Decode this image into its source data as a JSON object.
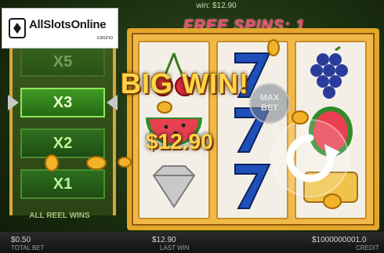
{
  "logo": {
    "brand": "AllSlotsOnline",
    "sub": ".casino"
  },
  "top_win": "win: $12.90",
  "free_spins": "FREE SPINS: 1",
  "multipliers": [
    {
      "label": "X5",
      "state": "dim"
    },
    {
      "label": "X3",
      "state": "active"
    },
    {
      "label": "X2",
      "state": "normal"
    },
    {
      "label": "X1",
      "state": "normal"
    }
  ],
  "ladder_label": "ALL REEL WINS",
  "big_win": "BIG WIN!",
  "win_amount": "$12.90",
  "max_bet": {
    "line1": "MAX",
    "line2": "BET"
  },
  "bottom": {
    "total_bet_value": "$0.50",
    "total_bet_label": "TOTAL BET",
    "last_win_value": "$12.90",
    "last_win_label": "LAST WIN",
    "credit_value": "$1000000001.0",
    "credit_label": "CREDIT"
  },
  "icons": [
    "cherry-icon",
    "seven-icon",
    "grapes-icon",
    "watermelon-icon",
    "diamond-icon",
    "spin-icon",
    "coin-icon"
  ],
  "colors": {
    "gold": "#e3a629",
    "green": "#2e6f1f",
    "win_text": "#ffd54a",
    "free_spins": "#e34a7a"
  }
}
